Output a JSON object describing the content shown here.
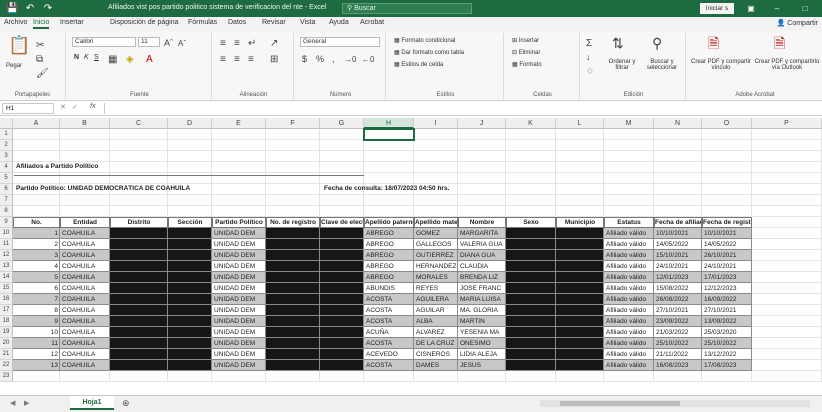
{
  "titlebar": {
    "title": "Afiliados vist pos partido politico sistema de verificacion del nte - Excel",
    "search": "Buscar",
    "signin": "Iniciar s",
    "icons": [
      "save-icon",
      "undo-icon",
      "redo-icon"
    ]
  },
  "menu": {
    "tabs": [
      "Archivo",
      "Inicio",
      "Insertar",
      "Disposición de página",
      "Fórmulas",
      "Datos",
      "Revisar",
      "Vista",
      "Ayuda",
      "Acrobat"
    ],
    "active": "Inicio",
    "share": "Compartir"
  },
  "ribbon": {
    "clipboard": {
      "paste": "Pegar",
      "label": "Portapapeles"
    },
    "font": {
      "name": "Calibri",
      "size": "11",
      "bold": "N",
      "italic": "K",
      "underline": "S",
      "label": "Fuente"
    },
    "alignment": {
      "label": "Alineación"
    },
    "number": {
      "format": "General",
      "label": "Número"
    },
    "styles": {
      "conditional": "Formato condicional",
      "table": "Dar formato como tabla",
      "cell": "Estilos de celda",
      "label": "Estilos"
    },
    "cells": {
      "insert": "Insertar",
      "delete": "Eliminar",
      "format": "Formato",
      "label": "Celdas"
    },
    "editing": {
      "sort": "Ordenar y filtrar",
      "find": "Buscar y seleccionar",
      "label": "Edición"
    },
    "acrobat": {
      "create_pdf": "Crear PDF y compartir vínculo",
      "create_outlook": "Crear PDF y compartirlo vía Outlook",
      "label": "Adobe Acrobat"
    }
  },
  "formula": {
    "namebox": "H1",
    "fx": "fx"
  },
  "grid": {
    "columns": [
      "A",
      "B",
      "C",
      "D",
      "E",
      "F",
      "G",
      "H",
      "I",
      "J",
      "K",
      "L",
      "M",
      "N",
      "O",
      "P"
    ],
    "selected_column": "H",
    "rows": [
      "1",
      "2",
      "3",
      "4",
      "5",
      "6",
      "7",
      "8",
      "9",
      "10",
      "11",
      "12",
      "13",
      "14",
      "15",
      "16",
      "17",
      "18",
      "19",
      "20",
      "21",
      "22",
      "23"
    ],
    "title_a4": "Afiliados a Partido Político",
    "partido_a6": "Partido Político: UNIDAD DEMOCRÁTICA DE COAHUILA",
    "fecha_g6": "Fecha de consulta: 18/07/2023 04:50 hrs.",
    "headers": [
      "No.",
      "Entidad",
      "Distrito",
      "Sección",
      "Partido Político",
      "No. de registro",
      "Clave de elector",
      "Apellido paterno",
      "Apellido materno",
      "Nombre",
      "Sexo",
      "Municipio",
      "Estatus",
      "Fecha de afiliación",
      "Fecha de registro"
    ],
    "data_rows": [
      {
        "no": "1",
        "entidad": "COAHUILA",
        "partido": "UNIDAD DEM",
        "ap": "ABREGO",
        "am": "GOMEZ",
        "nombre": "MARGARITA",
        "estatus": "Afiliado válido",
        "fa": "10/10/2021",
        "fr": "10/10/2021"
      },
      {
        "no": "2",
        "entidad": "COAHUILA",
        "partido": "UNIDAD DEM",
        "ap": "ABREGO",
        "am": "GALLEGOS",
        "nombre": "VALERIA GUA",
        "estatus": "Afiliado válido",
        "fa": "14/05/2022",
        "fr": "14/05/2022"
      },
      {
        "no": "3",
        "entidad": "COAHUILA",
        "partido": "UNIDAD DEM",
        "ap": "ABREGO",
        "am": "GUTIERREZ",
        "nombre": "DIANA GUA",
        "estatus": "Afiliado válido",
        "fa": "15/10/2021",
        "fr": "26/10/2021"
      },
      {
        "no": "4",
        "entidad": "COAHUILA",
        "partido": "UNIDAD DEM",
        "ap": "ABREGO",
        "am": "HERNANDEZ",
        "nombre": "CLAUDIA",
        "estatus": "Afiliado válido",
        "fa": "24/10/2021",
        "fr": "24/10/2021"
      },
      {
        "no": "5",
        "entidad": "COAHUILA",
        "partido": "UNIDAD DEM",
        "ap": "ABREGO",
        "am": "MORALES",
        "nombre": "BRENDA LIZ",
        "estatus": "Afiliado válido",
        "fa": "12/01/2023",
        "fr": "17/01/2023"
      },
      {
        "no": "6",
        "entidad": "COAHUILA",
        "partido": "UNIDAD DEM",
        "ap": "ABUNDIS",
        "am": "REYES",
        "nombre": "JOSE FRANC",
        "estatus": "Afiliado válido",
        "fa": "15/08/2022",
        "fr": "12/12/2023"
      },
      {
        "no": "7",
        "entidad": "COAHUILA",
        "partido": "UNIDAD DEM",
        "ap": "ACOSTA",
        "am": "AGUILERA",
        "nombre": "MARIA LUISA",
        "estatus": "Afiliado válido",
        "fa": "26/08/2022",
        "fr": "16/09/2022"
      },
      {
        "no": "8",
        "entidad": "COAHUILA",
        "partido": "UNIDAD DEM",
        "ap": "ACOSTA",
        "am": "AGUILAR",
        "nombre": "MA. GLORIA",
        "estatus": "Afiliado válido",
        "fa": "27/10/2021",
        "fr": "27/10/2021"
      },
      {
        "no": "9",
        "entidad": "COAHUILA",
        "partido": "UNIDAD DEM",
        "ap": "ACOSTA",
        "am": "ALBA",
        "nombre": "MARTIN",
        "estatus": "Afiliado válido",
        "fa": "23/09/2022",
        "fr": "13/09/2022"
      },
      {
        "no": "10",
        "entidad": "COAHUILA",
        "partido": "UNIDAD DEM",
        "ap": "ACUÑA",
        "am": "ALVAREZ",
        "nombre": "YESENIA MA",
        "estatus": "Afiliado válido",
        "fa": "21/03/2022",
        "fr": "25/03/2020"
      },
      {
        "no": "11",
        "entidad": "COAHUILA",
        "partido": "UNIDAD DEM",
        "ap": "ACOSTA",
        "am": "DE LA CRUZ",
        "nombre": "ONESIMO",
        "estatus": "Afiliado válido",
        "fa": "25/10/2022",
        "fr": "25/10/2022"
      },
      {
        "no": "12",
        "entidad": "COAHUILA",
        "partido": "UNIDAD DEM",
        "ap": "ACEVEDO",
        "am": "CISNEROS",
        "nombre": "LIDIA ALEJA",
        "estatus": "Afiliado válido",
        "fa": "21/11/2022",
        "fr": "13/12/2022"
      },
      {
        "no": "13",
        "entidad": "COAHUILA",
        "partido": "UNIDAD DEM",
        "ap": "ACOSTA",
        "am": "DAMES",
        "nombre": "JESUS",
        "estatus": "Afiliado válido",
        "fa": "16/08/2023",
        "fr": "17/08/2023"
      }
    ]
  },
  "sheets": {
    "tab": "Hoja1",
    "add": "⊕"
  }
}
